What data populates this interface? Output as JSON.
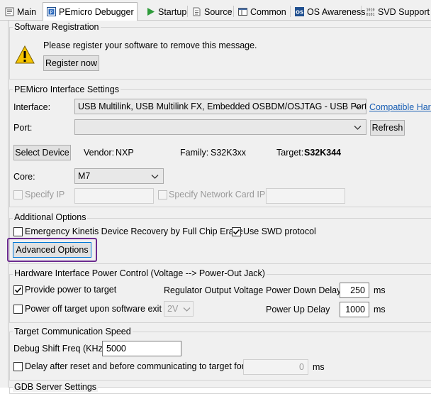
{
  "tabs": [
    {
      "label": "Main",
      "icon": "main-tab-icon"
    },
    {
      "label": "PEmicro Debugger",
      "icon": "debugger-tab-icon",
      "active": true
    },
    {
      "label": "Startup",
      "icon": "startup-tab-icon"
    },
    {
      "label": "Source",
      "icon": "source-tab-icon"
    },
    {
      "label": "Common",
      "icon": "common-tab-icon"
    },
    {
      "label": "OS Awareness",
      "icon": "os-awareness-tab-icon"
    },
    {
      "label": "SVD Support",
      "icon": "svd-support-tab-icon"
    }
  ],
  "registration": {
    "group_label": "Software Registration",
    "message": "Please register your software to remove this message.",
    "register_button": "Register now",
    "icon": "warning-icon"
  },
  "interface_settings": {
    "group_label": "PEMicro Interface Settings",
    "interface_label": "Interface:",
    "interface_value": "USB Multilink, USB Multilink FX, Embedded OSBDM/OSJTAG - USB Port",
    "compatible_link": "Compatible Hard",
    "port_label": "Port:",
    "port_value": "",
    "refresh_button": "Refresh",
    "select_device_button": "Select Device",
    "vendor_label": "Vendor:",
    "vendor_value": "NXP",
    "family_label": "Family:",
    "family_value": "S32K3xx",
    "target_label": "Target:",
    "target_value": "S32K344",
    "core_label": "Core:",
    "core_value": "M7",
    "specify_ip_label": "Specify IP",
    "specify_ip_checked": false,
    "ip_value": "",
    "specify_netcard_label": "Specify Network Card IP",
    "specify_netcard_checked": false,
    "netcard_value": ""
  },
  "additional_options": {
    "group_label": "Additional Options",
    "emergency_label": "Emergency Kinetis Device Recovery by Full Chip Erase",
    "emergency_checked": false,
    "swd_label": "Use SWD protocol",
    "swd_checked": true,
    "advanced_button": "Advanced Options"
  },
  "power_control": {
    "group_label": "Hardware Interface Power Control (Voltage --> Power-Out Jack)",
    "provide_power_label": "Provide power to target",
    "provide_power_checked": true,
    "power_off_label": "Power off target upon software exit",
    "power_off_checked": false,
    "regulator_label": "Regulator Output Voltage",
    "regulator_value": "2V",
    "power_down_label": "Power Down Delay",
    "power_down_value": "250",
    "power_down_unit": "ms",
    "power_up_label": "Power Up Delay",
    "power_up_value": "1000",
    "power_up_unit": "ms"
  },
  "comm_speed": {
    "group_label": "Target Communication Speed",
    "debug_shift_label": "Debug Shift Freq (KHz)",
    "debug_shift_value": "5000",
    "delay_label": "Delay after reset and before communicating to target for",
    "delay_checked": false,
    "delay_value": "0",
    "delay_unit": "ms"
  },
  "gdb_section": {
    "group_label": "GDB Server Settings"
  },
  "colors": {
    "highlight": "#6b2a8f",
    "link": "#1a5fb4",
    "panel_bg": "#f0f0f0",
    "warning_yellow": "#f5c400"
  }
}
